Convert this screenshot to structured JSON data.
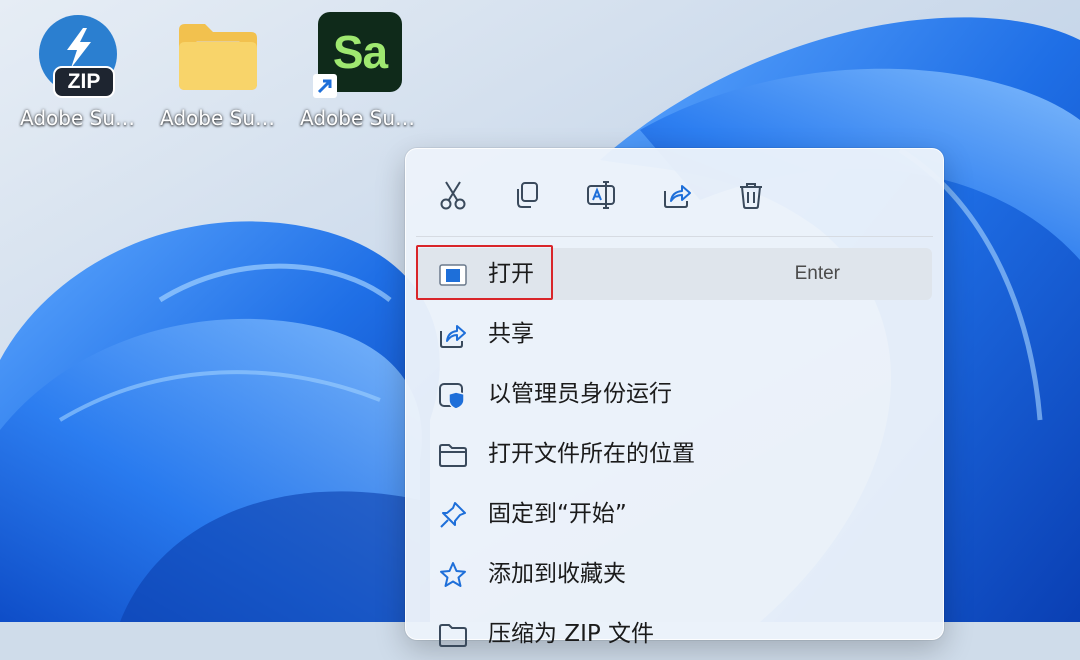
{
  "desktop": {
    "icons": [
      {
        "label": "Adobe Substanc...",
        "type": "zip-archive",
        "badge": "ZIP"
      },
      {
        "label": "Adobe Substanc...",
        "type": "folder"
      },
      {
        "label": "Adobe Substanc...",
        "type": "app-shortcut",
        "app_text": "Sa"
      }
    ]
  },
  "context_menu": {
    "toolbar": [
      {
        "name": "cut-icon"
      },
      {
        "name": "copy-icon"
      },
      {
        "name": "rename-icon"
      },
      {
        "name": "share-icon"
      },
      {
        "name": "delete-icon"
      }
    ],
    "items": [
      {
        "label": "打开",
        "accelerator": "Enter",
        "icon": "open-app-icon",
        "highlighted": true
      },
      {
        "label": "共享",
        "icon": "share-icon"
      },
      {
        "label": "以管理员身份运行",
        "icon": "admin-shield-icon"
      },
      {
        "label": "打开文件所在的位置",
        "icon": "folder-icon"
      },
      {
        "label": "固定到“开始”",
        "icon": "pin-icon"
      },
      {
        "label": "添加到收藏夹",
        "icon": "star-icon"
      },
      {
        "label": "压缩为 ZIP 文件",
        "icon": "zip-folder-icon"
      }
    ]
  },
  "colors": {
    "wallpaper_bg": "#cfdcea",
    "bloom_blue": "#1f6fe6",
    "highlight_border": "#d9252a",
    "menu_bg": "#ecf2fa"
  }
}
